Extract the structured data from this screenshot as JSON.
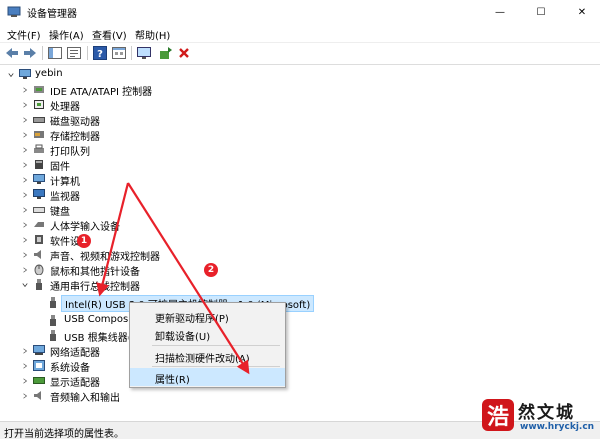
{
  "window": {
    "title": "设备管理器",
    "minimize": "—",
    "maximize": "☐",
    "close": "✕"
  },
  "menu": [
    {
      "label": "文件(F)"
    },
    {
      "label": "操作(A)"
    },
    {
      "label": "查看(V)"
    },
    {
      "label": "帮助(H)"
    }
  ],
  "tree": {
    "root": "yebin",
    "items": [
      {
        "label": "IDE ATA/ATAPI 控制器",
        "icon": "ide-controller-icon"
      },
      {
        "label": "处理器",
        "icon": "processor-icon"
      },
      {
        "label": "磁盘驱动器",
        "icon": "disk-drive-icon"
      },
      {
        "label": "存储控制器",
        "icon": "storage-controller-icon"
      },
      {
        "label": "打印队列",
        "icon": "printer-icon"
      },
      {
        "label": "固件",
        "icon": "firmware-icon"
      },
      {
        "label": "计算机",
        "icon": "computer-icon"
      },
      {
        "label": "监视器",
        "icon": "monitor-icon"
      },
      {
        "label": "键盘",
        "icon": "keyboard-icon"
      },
      {
        "label": "人体学输入设备",
        "icon": "hid-icon"
      },
      {
        "label": "软件设备",
        "icon": "software-device-icon"
      },
      {
        "label": "声音、视频和游戏控制器",
        "icon": "audio-icon"
      },
      {
        "label": "鼠标和其他指针设备",
        "icon": "mouse-icon"
      },
      {
        "label": "通用串行总线控制器",
        "icon": "usb-icon"
      }
    ],
    "usb_children": [
      {
        "label": "Intel(R) USB 3.0 可扩展主机控制器 - 1.0 (Microsoft)"
      },
      {
        "label": "USB Composite"
      },
      {
        "label": "USB 根集线器(U"
      }
    ],
    "after_items": [
      {
        "label": "网络适配器",
        "icon": "network-adapter-icon"
      },
      {
        "label": "系统设备",
        "icon": "system-device-icon"
      },
      {
        "label": "显示适配器",
        "icon": "display-adapter-icon"
      },
      {
        "label": "音频输入和输出",
        "icon": "audio-io-icon"
      }
    ]
  },
  "context_menu": {
    "items": [
      "更新驱动程序(P)",
      "卸载设备(U)",
      "扫描检测硬件改动(A)",
      "属性(R)"
    ]
  },
  "annotations": {
    "badge1": "1",
    "badge2": "2",
    "color": "#e8212a"
  },
  "status": {
    "text": "打开当前选择项的属性表。"
  },
  "watermark": {
    "logo_char": "浩",
    "name": "然文城",
    "url": "www.hryckj.cn"
  }
}
